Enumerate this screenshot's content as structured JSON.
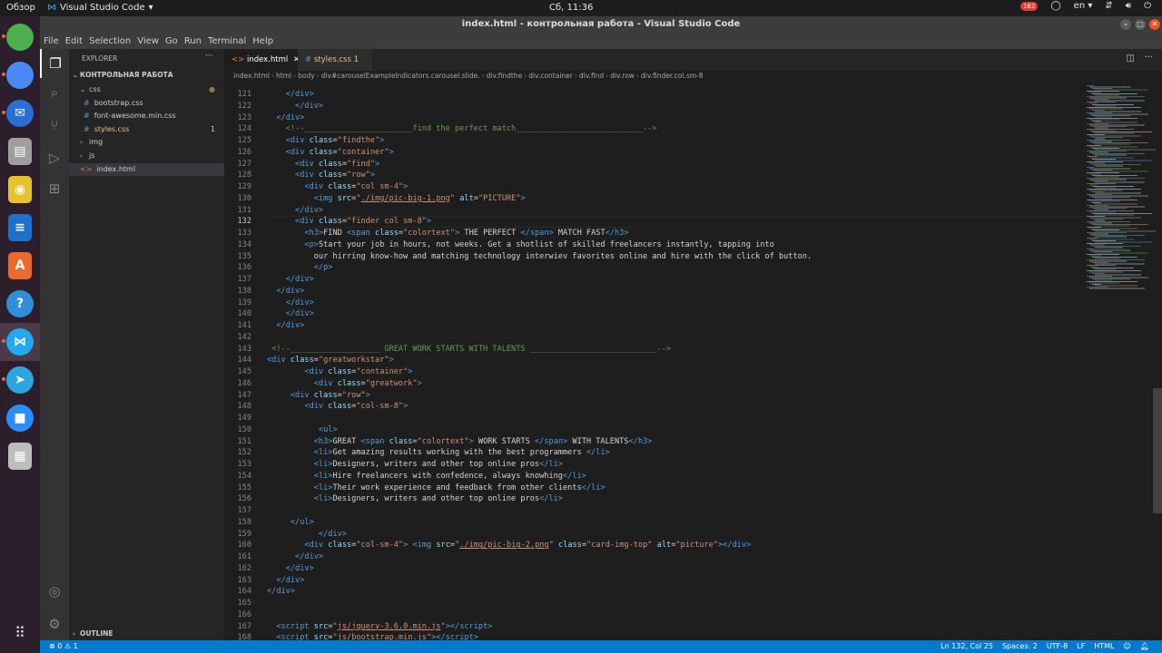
{
  "topbar": {
    "overview": "Обзор",
    "app_name": "Visual Studio Code",
    "clock": "Сб, 11:36",
    "notification_count": "162",
    "lang": "en"
  },
  "dock": {
    "items": [
      {
        "name": "chrome",
        "glyph": "",
        "color": "#4caf50"
      },
      {
        "name": "chromium",
        "glyph": "",
        "color": "#4a8af4"
      },
      {
        "name": "thunderbird",
        "glyph": "✉",
        "color": "#2a6fd6"
      },
      {
        "name": "files",
        "glyph": "▤",
        "color": "#9e9e9e"
      },
      {
        "name": "rhythmbox",
        "glyph": "◉",
        "color": "#e7c22b"
      },
      {
        "name": "writer",
        "glyph": "≡",
        "color": "#1b72c8"
      },
      {
        "name": "software",
        "glyph": "A",
        "color": "#e96b2e"
      },
      {
        "name": "help",
        "glyph": "?",
        "color": "#2f8fd8"
      },
      {
        "name": "vscode",
        "glyph": "⋈",
        "color": "#23a9f2"
      },
      {
        "name": "telegram",
        "glyph": "➤",
        "color": "#2ca5e0"
      },
      {
        "name": "zoom",
        "glyph": "■",
        "color": "#2d8cff"
      },
      {
        "name": "scanner",
        "glyph": "▦",
        "color": "#bdbdbd"
      }
    ]
  },
  "window": {
    "title": "index.html - контрольная работа - Visual Studio Code"
  },
  "menu": [
    "File",
    "Edit",
    "Selection",
    "View",
    "Go",
    "Run",
    "Terminal",
    "Help"
  ],
  "sidebar": {
    "explorer_title": "EXPLORER",
    "more": "···",
    "project": "КОНТРОЛЬНАЯ РАБОТА",
    "items": [
      {
        "label": "css",
        "kind": "folder-open",
        "indent": 1,
        "color": "#e2c08d",
        "dot": true
      },
      {
        "label": "bootstrap.css",
        "kind": "css",
        "indent": 2,
        "color": "#cccccc"
      },
      {
        "label": "font-awesome.min.css",
        "kind": "css",
        "indent": 2,
        "color": "#cccccc"
      },
      {
        "label": "styles.css",
        "kind": "css",
        "indent": 2,
        "color": "#e2c08d",
        "count": "1"
      },
      {
        "label": "img",
        "kind": "folder",
        "indent": 1,
        "color": "#cccccc"
      },
      {
        "label": "js",
        "kind": "folder",
        "indent": 1,
        "color": "#cccccc"
      },
      {
        "label": "index.html",
        "kind": "html",
        "indent": 1,
        "color": "#cccccc",
        "selected": true
      }
    ],
    "outline": "OUTLINE"
  },
  "tabs": [
    {
      "label": "index.html",
      "active": true
    },
    {
      "label": "styles.css",
      "count": "1",
      "active": false
    }
  ],
  "breadcrumb": [
    "index.html",
    "html",
    "body",
    "div#carouselExampleIndicators.carousel.slide.",
    "div.findthe",
    "div.container",
    "div.find",
    "div.row",
    "div.finder.col.sm-8"
  ],
  "current_line": "132",
  "editor": {
    "lines": [
      {
        "n": "121",
        "h": "<span class=\"p\">    </span><span class=\"t\">&lt;/div&gt;</span>"
      },
      {
        "n": "122",
        "h": "<span class=\"p\">      </span><span class=\"t\">&lt;/div&gt;</span>"
      },
      {
        "n": "123",
        "h": "<span class=\"p\">  </span><span class=\"t\">&lt;/div&gt;</span>"
      },
      {
        "n": "124",
        "h": "    <span class=\"c\">&lt;!--_______________________find the perfect match___________________________--&gt;</span>"
      },
      {
        "n": "125",
        "h": "    <span class=\"t\">&lt;div</span> <span class=\"a\">class</span>=<span class=\"s\">\"findthe\"</span><span class=\"t\">&gt;</span>"
      },
      {
        "n": "126",
        "h": "    <span class=\"t\">&lt;div</span> <span class=\"a\">class</span>=<span class=\"s\">\"container\"</span><span class=\"t\">&gt;</span>"
      },
      {
        "n": "127",
        "h": "      <span class=\"t\">&lt;div</span> <span class=\"a\">class</span>=<span class=\"s\">\"find\"</span><span class=\"t\">&gt;</span>"
      },
      {
        "n": "128",
        "h": "      <span class=\"t\">&lt;div</span> <span class=\"a\">class</span>=<span class=\"s\">\"row\"</span><span class=\"t\">&gt;</span>"
      },
      {
        "n": "129",
        "h": "        <span class=\"t\">&lt;div</span> <span class=\"a\">class</span>=<span class=\"s\">\"col sm-4\"</span><span class=\"t\">&gt;</span>"
      },
      {
        "n": "130",
        "h": "          <span class=\"t\">&lt;img</span> <span class=\"a\">src</span>=<span class=\"s\">\"<span class=\"su\">./img/pic-big-1.png</span>\"</span> <span class=\"a\">alt</span>=<span class=\"s\">\"PICTURE\"</span><span class=\"t\">&gt;</span>"
      },
      {
        "n": "131",
        "h": "      <span class=\"t\">&lt;/div&gt;</span>"
      },
      {
        "n": "132",
        "h": "      <span class=\"t\">&lt;div</span> <span class=\"a\">class</span>=<span class=\"s\">\"finder col sm-8\"</span><span class=\"t\">&gt;</span>"
      },
      {
        "n": "133",
        "h": "        <span class=\"t\">&lt;h3&gt;</span>FIND <span class=\"t\">&lt;span</span> <span class=\"a\">class</span>=<span class=\"s\">\"colortext\"</span><span class=\"t\">&gt;</span> THE PERFECT <span class=\"t\">&lt;/span&gt;</span> MATCH FAST<span class=\"t\">&lt;/h3&gt;</span>"
      },
      {
        "n": "134",
        "h": "        <span class=\"t\">&lt;p&gt;</span>Start your job in hours, not weeks. Get a shotlist of skilled freelancers instantly, tapping into"
      },
      {
        "n": "135",
        "h": "          our hirring know-how and matching technology interwiev favorites online and hire with the click of button."
      },
      {
        "n": "136",
        "h": "          <span class=\"t\">&lt;/p&gt;</span>"
      },
      {
        "n": "137",
        "h": "    <span class=\"t\">&lt;/div&gt;</span>"
      },
      {
        "n": "138",
        "h": "  <span class=\"t\">&lt;/div&gt;</span>"
      },
      {
        "n": "139",
        "h": "    <span class=\"t\">&lt;/div&gt;</span>"
      },
      {
        "n": "140",
        "h": "    <span class=\"t\">&lt;/div&gt;</span>"
      },
      {
        "n": "141",
        "h": "  <span class=\"t\">&lt;/div&gt;</span>"
      },
      {
        "n": "142",
        "h": ""
      },
      {
        "n": "143",
        "h": " <span class=\"c\">&lt;!--___________________ GREAT WORK STARTS WITH TALENTS ___________________________--&gt;</span>"
      },
      {
        "n": "144",
        "h": "<span class=\"t\">&lt;div</span> <span class=\"a\">class</span>=<span class=\"s\">\"greatworkstar\"</span><span class=\"t\">&gt;</span>"
      },
      {
        "n": "145",
        "h": "        <span class=\"t\">&lt;div</span> <span class=\"a\">class</span>=<span class=\"s\">\"container\"</span><span class=\"t\">&gt;</span>"
      },
      {
        "n": "146",
        "h": "          <span class=\"t\">&lt;div</span> <span class=\"a\">class</span>=<span class=\"s\">\"greatwork\"</span><span class=\"t\">&gt;</span>"
      },
      {
        "n": "147",
        "h": "     <span class=\"t\">&lt;div</span> <span class=\"a\">class</span>=<span class=\"s\">\"row\"</span><span class=\"t\">&gt;</span>"
      },
      {
        "n": "148",
        "h": "        <span class=\"t\">&lt;div</span> <span class=\"a\">class</span>=<span class=\"s\">\"col-sm-8\"</span><span class=\"t\">&gt;</span>"
      },
      {
        "n": "149",
        "h": ""
      },
      {
        "n": "150",
        "h": "           <span class=\"t\">&lt;ul&gt;</span>"
      },
      {
        "n": "151",
        "h": "          <span class=\"t\">&lt;h3&gt;</span>GREAT <span class=\"t\">&lt;span</span> <span class=\"a\">class</span>=<span class=\"s\">\"colortext\"</span><span class=\"t\">&gt;</span> WORK STARTS <span class=\"t\">&lt;/span&gt;</span> WITH TALENTS<span class=\"t\">&lt;/h3&gt;</span>"
      },
      {
        "n": "152",
        "h": "          <span class=\"t\">&lt;li&gt;</span>Get amazing results working with the best programmers <span class=\"t\">&lt;/li&gt;</span>"
      },
      {
        "n": "153",
        "h": "          <span class=\"t\">&lt;li&gt;</span>Designers, writers and other top online pros<span class=\"t\">&lt;/li&gt;</span>"
      },
      {
        "n": "154",
        "h": "          <span class=\"t\">&lt;li&gt;</span>Hire freelancers with confedence, always knowhing<span class=\"t\">&lt;/li&gt;</span>"
      },
      {
        "n": "155",
        "h": "          <span class=\"t\">&lt;li&gt;</span>Their work experience and feedback from other clients<span class=\"t\">&lt;/li&gt;</span>"
      },
      {
        "n": "156",
        "h": "          <span class=\"t\">&lt;li&gt;</span>Designers, writers and other top online pros<span class=\"t\">&lt;/li&gt;</span>"
      },
      {
        "n": "157",
        "h": ""
      },
      {
        "n": "158",
        "h": "     <span class=\"t\">&lt;/ul&gt;</span>"
      },
      {
        "n": "159",
        "h": "           <span class=\"t\">&lt;/div&gt;</span>"
      },
      {
        "n": "160",
        "h": "        <span class=\"t\">&lt;div</span> <span class=\"a\">class</span>=<span class=\"s\">\"col-sm-4\"</span><span class=\"t\">&gt;</span> <span class=\"t\">&lt;img</span> <span class=\"a\">src</span>=<span class=\"s\">\"<span class=\"su\">./img/pic-big-2.png</span>\"</span> <span class=\"a\">class</span>=<span class=\"s\">\"card-img-top\"</span> <span class=\"a\">alt</span>=<span class=\"s\">\"picture\"</span><span class=\"t\">&gt;&lt;/div&gt;</span>"
      },
      {
        "n": "161",
        "h": "      <span class=\"t\">&lt;/div&gt;</span>"
      },
      {
        "n": "162",
        "h": "    <span class=\"t\">&lt;/div&gt;</span>"
      },
      {
        "n": "163",
        "h": "  <span class=\"t\">&lt;/div&gt;</span>"
      },
      {
        "n": "164",
        "h": "<span class=\"t\">&lt;/div&gt;</span>"
      },
      {
        "n": "165",
        "h": ""
      },
      {
        "n": "166",
        "h": ""
      },
      {
        "n": "167",
        "h": "  <span class=\"t\">&lt;script</span> <span class=\"a\">src</span>=<span class=\"s\">\"<span class=\"su\">js/jquery-3.6.0.min.js</span>\"</span><span class=\"t\">&gt;&lt;/script&gt;</span>"
      },
      {
        "n": "168",
        "h": "  <span class=\"t\">&lt;script</span> <span class=\"a\">src</span>=<span class=\"s\">\"<span class=\"su\">js/bootstrap.min.js</span>\"</span><span class=\"t\">&gt;&lt;/script&gt;</span>"
      }
    ]
  },
  "status": {
    "problems": "⊗ 0 ⚠ 1",
    "position": "Ln 132, Col 25",
    "spaces": "Spaces: 2",
    "encoding": "UTF-8",
    "eol": "LF",
    "language": "HTML"
  }
}
